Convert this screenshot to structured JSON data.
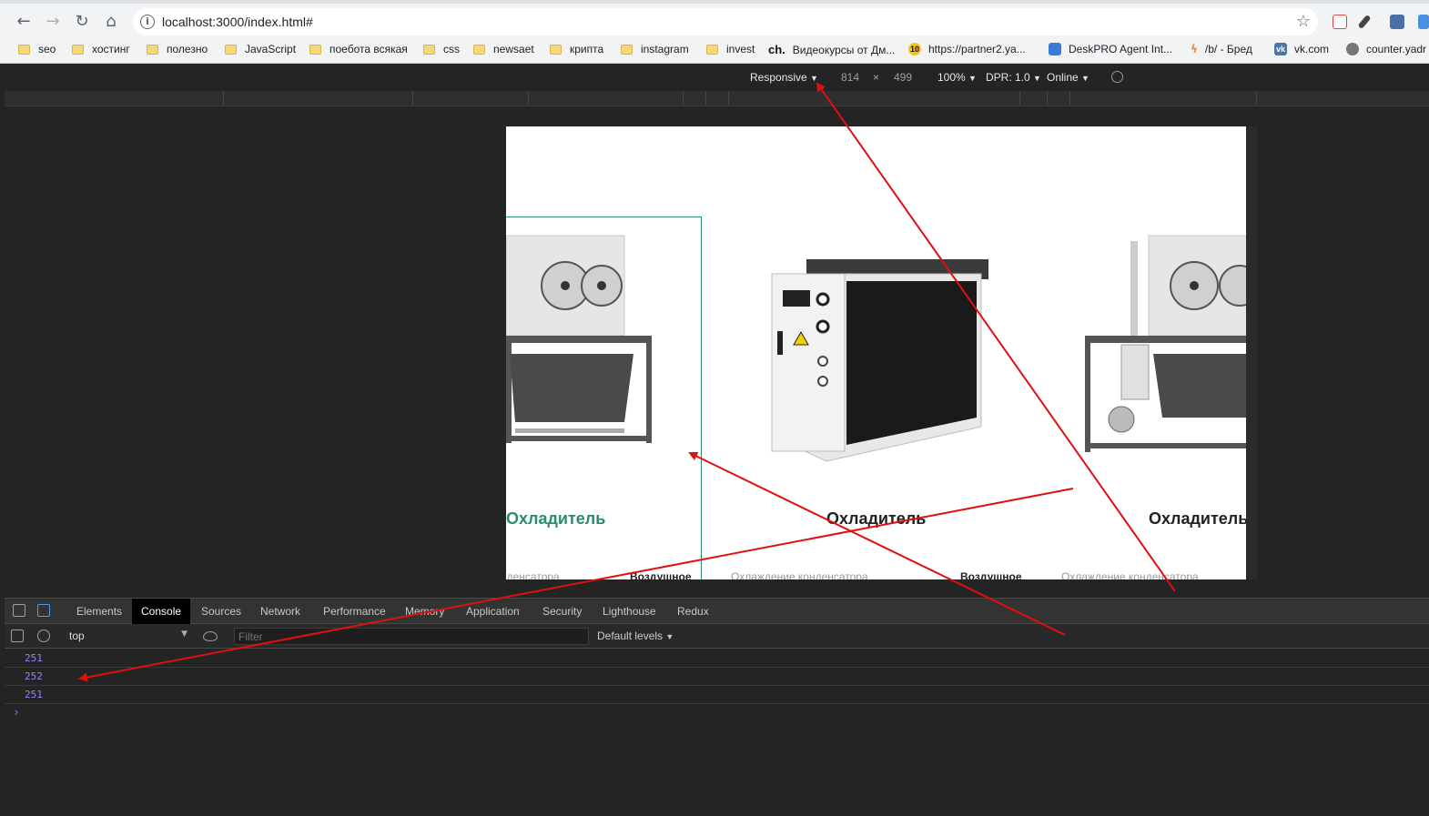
{
  "browser": {
    "url": "localhost:3000/index.html#",
    "bookmarks": [
      {
        "label": "seo",
        "icon": "folder-icon"
      },
      {
        "label": "хостинг",
        "icon": "folder-icon"
      },
      {
        "label": "полезно",
        "icon": "folder-icon"
      },
      {
        "label": "JavaScript",
        "icon": "folder-icon"
      },
      {
        "label": "поебота всякая",
        "icon": "folder-icon"
      },
      {
        "label": "css",
        "icon": "folder-icon"
      },
      {
        "label": "newsaet",
        "icon": "folder-icon"
      },
      {
        "label": "крипта",
        "icon": "folder-icon"
      },
      {
        "label": "instagram",
        "icon": "folder-icon"
      },
      {
        "label": "invest",
        "icon": "folder-icon"
      },
      {
        "label": "Видеокурсы от Дм...",
        "icon": "ch-icon",
        "icon_text": "ch."
      },
      {
        "label": "https://partner2.ya...",
        "icon": "yandex-icon",
        "icon_text": "10"
      },
      {
        "label": "DeskPRO Agent Int...",
        "icon": "deskpro-icon"
      },
      {
        "label": "/b/ - Бред",
        "icon": "lightning-icon"
      },
      {
        "label": "vk.com",
        "icon": "vk-icon"
      },
      {
        "label": "counter.yadr",
        "icon": "globe-icon"
      }
    ]
  },
  "device_toolbar": {
    "mode": "Responsive",
    "width": "814",
    "times": "×",
    "height": "499",
    "zoom": "100%",
    "dpr": "DPR: 1.0",
    "network": "Online"
  },
  "page": {
    "cards": [
      {
        "title": "Охладитель",
        "sub_left": "нденсатора",
        "sub_right": "Воздушное"
      },
      {
        "title": "Охладитель",
        "sub_left": "Охлаждение конденсатора",
        "sub_right": "Воздушное"
      },
      {
        "title": "Охладитель",
        "sub_left": "Охлаждение конденсатора"
      }
    ]
  },
  "devtools": {
    "tabs": [
      "Elements",
      "Console",
      "Sources",
      "Network",
      "Performance",
      "Memory",
      "Application",
      "Security",
      "Lighthouse",
      "Redux"
    ],
    "active_tab": "Console",
    "context": "top",
    "filter_placeholder": "Filter",
    "levels": "Default levels",
    "console_lines": [
      "251",
      "252",
      "251"
    ],
    "prompt": "›"
  },
  "colors": {
    "accent_green": "#2a8b6d",
    "annotation_red": "#e01010",
    "console_number": "#9980ff"
  }
}
